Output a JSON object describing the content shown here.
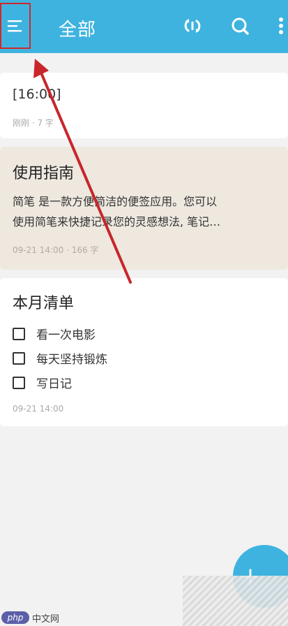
{
  "header": {
    "title": "全部",
    "icons": [
      "menu-icon",
      "sync-icon",
      "search-icon",
      "more-vertical-icon"
    ]
  },
  "notes": [
    {
      "text": "[16:00]",
      "meta": "刚刚 · 7 字"
    },
    {
      "title": "使用指南",
      "body_line1": "简笔 是一款方便简洁的便签应用。您可以",
      "body_line2": "使用简笔来快捷记录您的灵感想法, 笔记…",
      "meta": "09-21 14:00 · 166 字"
    },
    {
      "title": "本月清单",
      "checklist": [
        "看一次电影",
        "每天坚持锻炼",
        "写日记"
      ],
      "meta": "09-21 14:00"
    }
  ],
  "fab": {
    "label": "+"
  },
  "watermark": {
    "logo": "php",
    "text": "中文网"
  },
  "colors": {
    "appbar": "#3fb3df",
    "highlight_box": "#d0282a",
    "arrow": "#c8262b",
    "selected_note_bg": "#eee8df"
  }
}
